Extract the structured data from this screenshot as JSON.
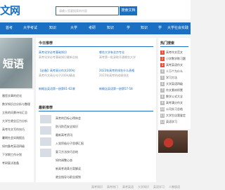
{
  "header": {
    "logo": "文网",
    "search_placeholder": "请输入您要搜索的内容",
    "search_button": "搜索文档"
  },
  "nav": [
    "首考",
    "大学考试",
    "知识",
    "大学",
    "考研",
    "知识",
    "学",
    "知识",
    "学",
    "大学社会实践"
  ],
  "banner": {
    "text": "短语"
  },
  "today": {
    "title": "今日推荐",
    "items": [
      {
        "title": "高考化学必考基础知识",
        "sub": "高考化学必考基础知识最新总结"
      },
      {
        "title": "哪些大学有北京专业",
        "sub": "高考第一批录取开通哪些大学"
      },
      {
        "title": "【必备】高考高分作文200句",
        "sub": "高考作文高分句子200句精选"
      },
      {
        "title": "2023年高考的排名什么表格",
        "sub": "2023年高考的成绩排名"
      },
      {
        "title": "新概念英语第一册第61-62课",
        "sub": ""
      },
      {
        "title": "新概念英语第一册第57-58",
        "sub": ""
      }
    ]
  },
  "latest": {
    "title": "最新推荐",
    "items": [
      "高考的目标心得体会",
      "防汛防范安全知识",
      "最新高考资讯",
      "入党积极分子思想汇报",
      "复习方法技巧总结",
      "如何调整心态",
      "新高考改革方案解读",
      "就业指导与职业规划"
    ]
  },
  "left_list": [
    "雅思文章的优化",
    "数学知识点分析与整理",
    "立秋的风景诗句汇总",
    "大学生就业压力分析",
    "高考作文写作技巧",
    "暑期社会实践报告",
    "如何备考英语四级",
    "下学期工作计划",
    "考研复试准备"
  ],
  "hot": {
    "title": "热门搜索",
    "items": [
      "高考作文范文",
      "小学数学练习题",
      "高考英语作文",
      "十万个为什么",
      "学习方法",
      "大学英语四级",
      "作文素材积累",
      "数学公式大全",
      "高考满分作文",
      "公司实习总结",
      "大学生自我鉴定",
      "英语学习"
    ]
  },
  "footer": [
    "高考知识",
    "高考热门",
    "高考英语",
    "大学知识",
    "英语学习",
    "人教版语"
  ]
}
